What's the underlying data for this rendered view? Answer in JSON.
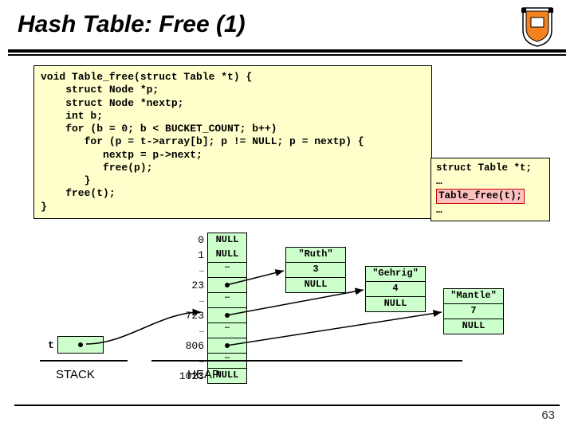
{
  "title": "Hash Table: Free (1)",
  "code": "void Table_free(struct Table *t) {\n    struct Node *p;\n    struct Node *nextp;\n    int b;\n    for (b = 0; b < BUCKET_COUNT; b++)\n       for (p = t->array[b]; p != NULL; p = nextp) {\n          nextp = p->next;\n          free(p);\n       }\n    free(t);\n}",
  "caller": {
    "l1": "struct Table *t;",
    "l2": "…",
    "l3": "Table_free(t);",
    "l4": "…"
  },
  "diagram": {
    "stack_var": "t",
    "stack_label": "STACK",
    "heap_label": "HEAP",
    "indices": [
      "0",
      "1",
      "23",
      "723",
      "806",
      "1023"
    ],
    "null": "NULL",
    "dots": "…",
    "nodes": {
      "ruth": {
        "key": "\"Ruth\"",
        "val": "3"
      },
      "gehrig": {
        "key": "\"Gehrig\"",
        "val": "4"
      },
      "mantle": {
        "key": "\"Mantle\"",
        "val": "7"
      }
    }
  },
  "pagenum": "63"
}
